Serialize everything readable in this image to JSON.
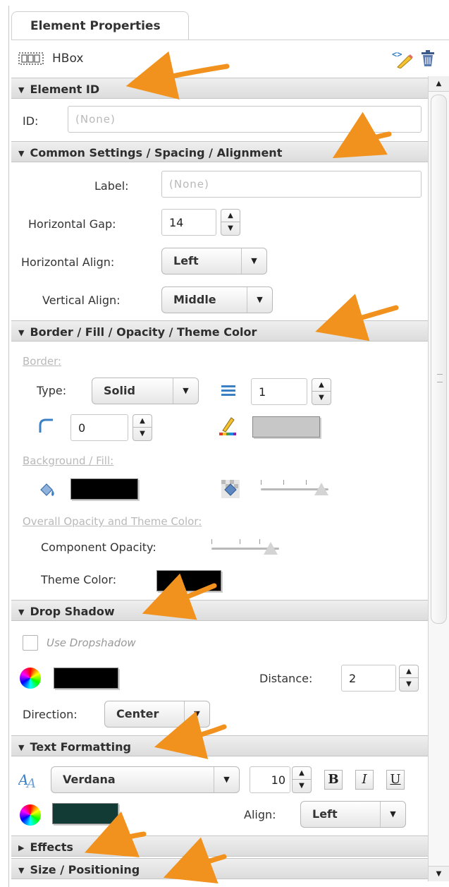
{
  "tab": {
    "label": "Element Properties"
  },
  "toolbar": {
    "element_name": "HBox"
  },
  "sections": {
    "element_id": "Element ID",
    "common": "Common Settings / Spacing / Alignment",
    "border": "Border / Fill / Opacity / Theme Color",
    "drop_shadow": "Drop Shadow",
    "text_formatting": "Text Formatting",
    "effects": "Effects",
    "size": "Size / Positioning"
  },
  "element_id": {
    "label": "ID:",
    "placeholder": "(None)"
  },
  "common": {
    "label_label": "Label:",
    "label_placeholder": "(None)",
    "hgap_label": "Horizontal Gap:",
    "hgap_value": "14",
    "halign_label": "Horizontal Align:",
    "halign_value": "Left",
    "valign_label": "Vertical Align:",
    "valign_value": "Middle"
  },
  "border": {
    "border_heading": "Border:",
    "type_label": "Type:",
    "type_value": "Solid",
    "weight_value": "1",
    "radius_value": "0",
    "border_color": "#c7c7c7",
    "fill_heading": "Background / Fill:",
    "fill_color": "#000000",
    "fill_alpha": 1.0,
    "opacity_heading": "Overall Opacity and Theme Color:",
    "opacity_label": "Component Opacity:",
    "opacity_value": 1.0,
    "theme_label": "Theme Color:",
    "theme_color": "#000000"
  },
  "drop_shadow": {
    "use_label": "Use Dropshadow",
    "checked": false,
    "color": "#000000",
    "distance_label": "Distance:",
    "distance_value": "2",
    "direction_label": "Direction:",
    "direction_value": "Center"
  },
  "text_formatting": {
    "font_value": "Verdana",
    "size_value": "10",
    "bold": "B",
    "italic": "I",
    "underline": "U",
    "color": "#133b36",
    "align_label": "Align:",
    "align_value": "Left"
  },
  "colors": {
    "accent_arrow": "#f2921e",
    "icon_blue": "#3b7fc4"
  }
}
